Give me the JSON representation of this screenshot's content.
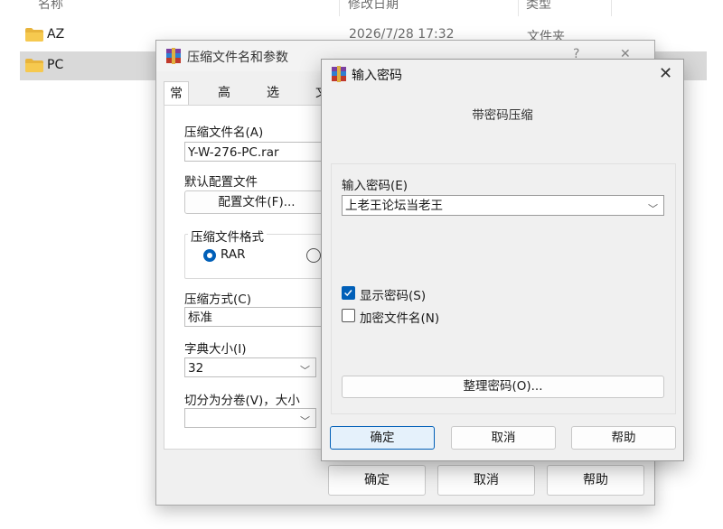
{
  "explorer": {
    "columns": {
      "name": "名称",
      "date": "修改日期",
      "type": "类型"
    },
    "rows": [
      {
        "name": "AZ",
        "date": "2026/7/28 17:32",
        "type": "文件夹"
      },
      {
        "name": "PC",
        "date": "",
        "type": ""
      }
    ]
  },
  "back_dialog": {
    "title": "压缩文件名和参数",
    "help_glyph": "?",
    "close_glyph": "✕",
    "tabs": [
      "常规",
      "高级",
      "选项",
      "文"
    ],
    "archive_name_label": "压缩文件名(A)",
    "archive_name_value": "Y-W-276-PC.rar",
    "profile_label": "默认配置文件",
    "profile_button": "配置文件(F)...",
    "format_group": "压缩文件格式",
    "format_rar": "RAR",
    "method_label": "压缩方式(C)",
    "method_value": "标准",
    "dict_label": "字典大小(I)",
    "dict_value": "32",
    "split_label": "切分为分卷(V)，大小",
    "split_value": "",
    "ok": "确定",
    "cancel": "取消",
    "help": "帮助"
  },
  "front_dialog": {
    "title": "输入密码",
    "close_glyph": "✕",
    "subtitle": "带密码压缩",
    "password_label": "输入密码(E)",
    "password_value": "上老王论坛当老王",
    "show_password": "显示密码(S)",
    "show_password_checked": true,
    "encrypt_names": "加密文件名(N)",
    "encrypt_names_checked": false,
    "organize_button": "整理密码(O)...",
    "ok": "确定",
    "cancel": "取消",
    "help": "帮助"
  },
  "colors": {
    "accent": "#005fb8",
    "folder": "#f2c14e",
    "selected_row": "#d9d9d9",
    "dialog_bg": "#f0f0f0"
  }
}
